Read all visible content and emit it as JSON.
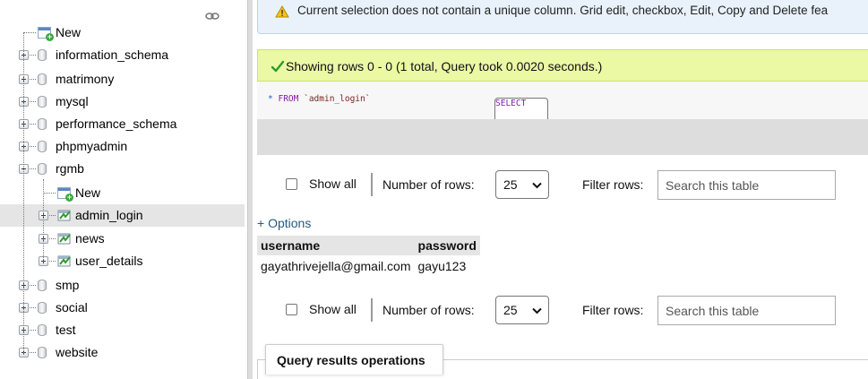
{
  "sidebar": {
    "link_icon": "chain-link-icon",
    "items": [
      {
        "label": "New",
        "icon": "new-icon"
      },
      {
        "label": "information_schema",
        "icon": "database-icon"
      },
      {
        "label": "matrimony",
        "icon": "database-icon"
      },
      {
        "label": "mysql",
        "icon": "database-icon"
      },
      {
        "label": "performance_schema",
        "icon": "database-icon"
      },
      {
        "label": "phpmyadmin",
        "icon": "database-icon"
      },
      {
        "label": "rgmb",
        "icon": "database-icon",
        "expanded": true
      },
      {
        "label": "New",
        "icon": "new-icon"
      },
      {
        "label": "admin_login",
        "icon": "table-icon",
        "selected": true
      },
      {
        "label": "news",
        "icon": "table-icon"
      },
      {
        "label": "user_details",
        "icon": "table-icon"
      },
      {
        "label": "smp",
        "icon": "database-icon"
      },
      {
        "label": "social",
        "icon": "database-icon"
      },
      {
        "label": "test",
        "icon": "database-icon"
      },
      {
        "label": "website",
        "icon": "database-icon"
      }
    ]
  },
  "main": {
    "notice": "Current selection does not contain a unique column. Grid edit, checkbox, Edit, Copy and Delete fea",
    "success": "Showing rows 0 - 0 (1 total, Query took 0.0020 seconds.)",
    "sql": {
      "select": "SELECT",
      "star": "*",
      "from": "FROM",
      "table": "`admin_login`"
    },
    "nav": {
      "show_all": "Show all",
      "number_of_rows_label": "Number of rows:",
      "rows_value": "25",
      "filter_label": "Filter rows:",
      "search_placeholder": "Search this table"
    },
    "options_link": "+ Options",
    "table": {
      "columns": [
        "username",
        "password"
      ],
      "rows": [
        [
          "gayathrivejella@gmail.com",
          "gayu123"
        ]
      ]
    },
    "query_results_operations": "Query results operations"
  },
  "colors": {
    "success_bg": "#ebf8a4",
    "notice_bg": "#e9f2fb",
    "link": "#235a81",
    "header_bg": "#e5e5e5"
  }
}
